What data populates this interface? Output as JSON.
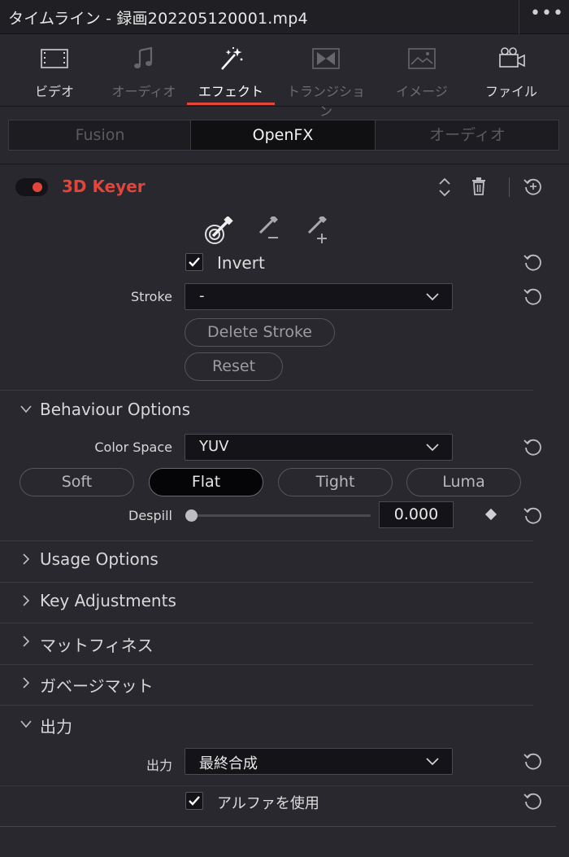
{
  "window": {
    "title": "タイムライン - 録画202205120001.mp4",
    "more_label": "•••"
  },
  "toolbar": {
    "items": [
      {
        "label": "ビデオ",
        "icon": "film-icon",
        "state": "normal"
      },
      {
        "label": "オーディオ",
        "icon": "music-note-icon",
        "state": "dim"
      },
      {
        "label": "エフェクト",
        "icon": "magic-wand-icon",
        "state": "active"
      },
      {
        "label": "トランジション",
        "icon": "transition-icon",
        "state": "dim"
      },
      {
        "label": "イメージ",
        "icon": "image-icon",
        "state": "dim"
      },
      {
        "label": "ファイル",
        "icon": "camera-file-icon",
        "state": "normal"
      }
    ],
    "accent_color": "#e2453a"
  },
  "tabs": [
    "Fusion",
    "OpenFX",
    "オーディオ"
  ],
  "tabs_selected": "OpenFX",
  "effect": {
    "name": "3D Keyer",
    "enabled": true,
    "color": "#e2453a",
    "picker_icons": [
      "eyedropper-target-icon",
      "eyedropper-minus-icon",
      "eyedropper-plus-icon"
    ],
    "invert": {
      "label": "Invert",
      "checked": true
    },
    "stroke": {
      "label": "Stroke",
      "value": "-"
    },
    "delete_stroke_label": "Delete Stroke",
    "reset_label": "Reset"
  },
  "behaviour": {
    "title": "Behaviour Options",
    "expanded": true,
    "color_space_label": "Color Space",
    "color_space_value": "YUV",
    "modes": [
      "Soft",
      "Flat",
      "Tight",
      "Luma"
    ],
    "mode_selected": "Flat",
    "despill_label": "Despill",
    "despill_value": "0.000"
  },
  "sections": [
    {
      "title": "Usage Options",
      "expanded": false
    },
    {
      "title": "Key Adjustments",
      "expanded": false
    },
    {
      "title": "マットフィネス",
      "expanded": false
    },
    {
      "title": "ガベージマット",
      "expanded": false
    }
  ],
  "output": {
    "title": "出力",
    "expanded": true,
    "output_label": "出力",
    "output_value": "最終合成",
    "use_alpha": {
      "label": "アルファを使用",
      "checked": true
    }
  }
}
